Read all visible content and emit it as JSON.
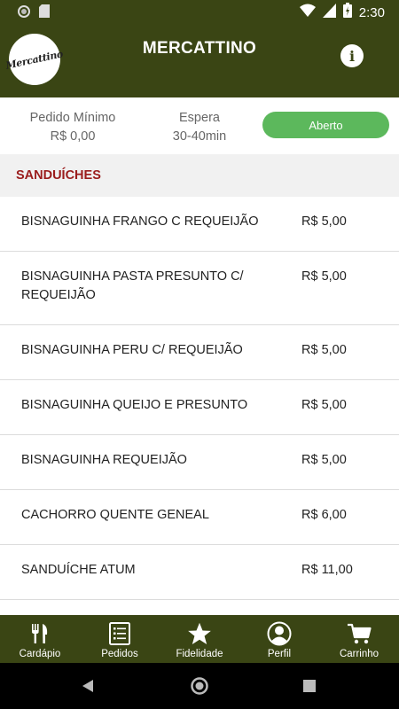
{
  "status_bar": {
    "time": "2:30"
  },
  "app_bar": {
    "title": "MERCATTINO",
    "logo_text": "Mercattino",
    "info_label": "i"
  },
  "store_info": {
    "min_order_label": "Pedido Mínimo",
    "min_order_value": "R$ 0,00",
    "wait_label": "Espera",
    "wait_value": "30-40min",
    "status": "Aberto",
    "status_color": "#5cb85c"
  },
  "section": {
    "title": "SANDUÍCHES",
    "title_color": "#9a1c1c"
  },
  "items": [
    {
      "name": "BISNAGUINHA FRANGO C REQUEIJÃO",
      "price": "R$ 5,00"
    },
    {
      "name": "BISNAGUINHA PASTA PRESUNTO C/ REQUEIJÃO",
      "price": "R$ 5,00"
    },
    {
      "name": "BISNAGUINHA PERU C/ REQUEIJÃO",
      "price": "R$ 5,00"
    },
    {
      "name": "BISNAGUINHA QUEIJO E PRESUNTO",
      "price": "R$ 5,00"
    },
    {
      "name": "BISNAGUINHA REQUEIJÃO",
      "price": "R$ 5,00"
    },
    {
      "name": "CACHORRO QUENTE GENEAL",
      "price": "R$ 6,00"
    },
    {
      "name": "SANDUÍCHE ATUM",
      "price": "R$ 11,00"
    }
  ],
  "bottom_nav": [
    {
      "label": "Cardápio",
      "icon": "fork-knife-icon"
    },
    {
      "label": "Pedidos",
      "icon": "list-icon"
    },
    {
      "label": "Fidelidade",
      "icon": "star-icon"
    },
    {
      "label": "Perfil",
      "icon": "person-icon"
    },
    {
      "label": "Carrinho",
      "icon": "cart-icon"
    }
  ],
  "colors": {
    "brand": "#3a4514"
  }
}
